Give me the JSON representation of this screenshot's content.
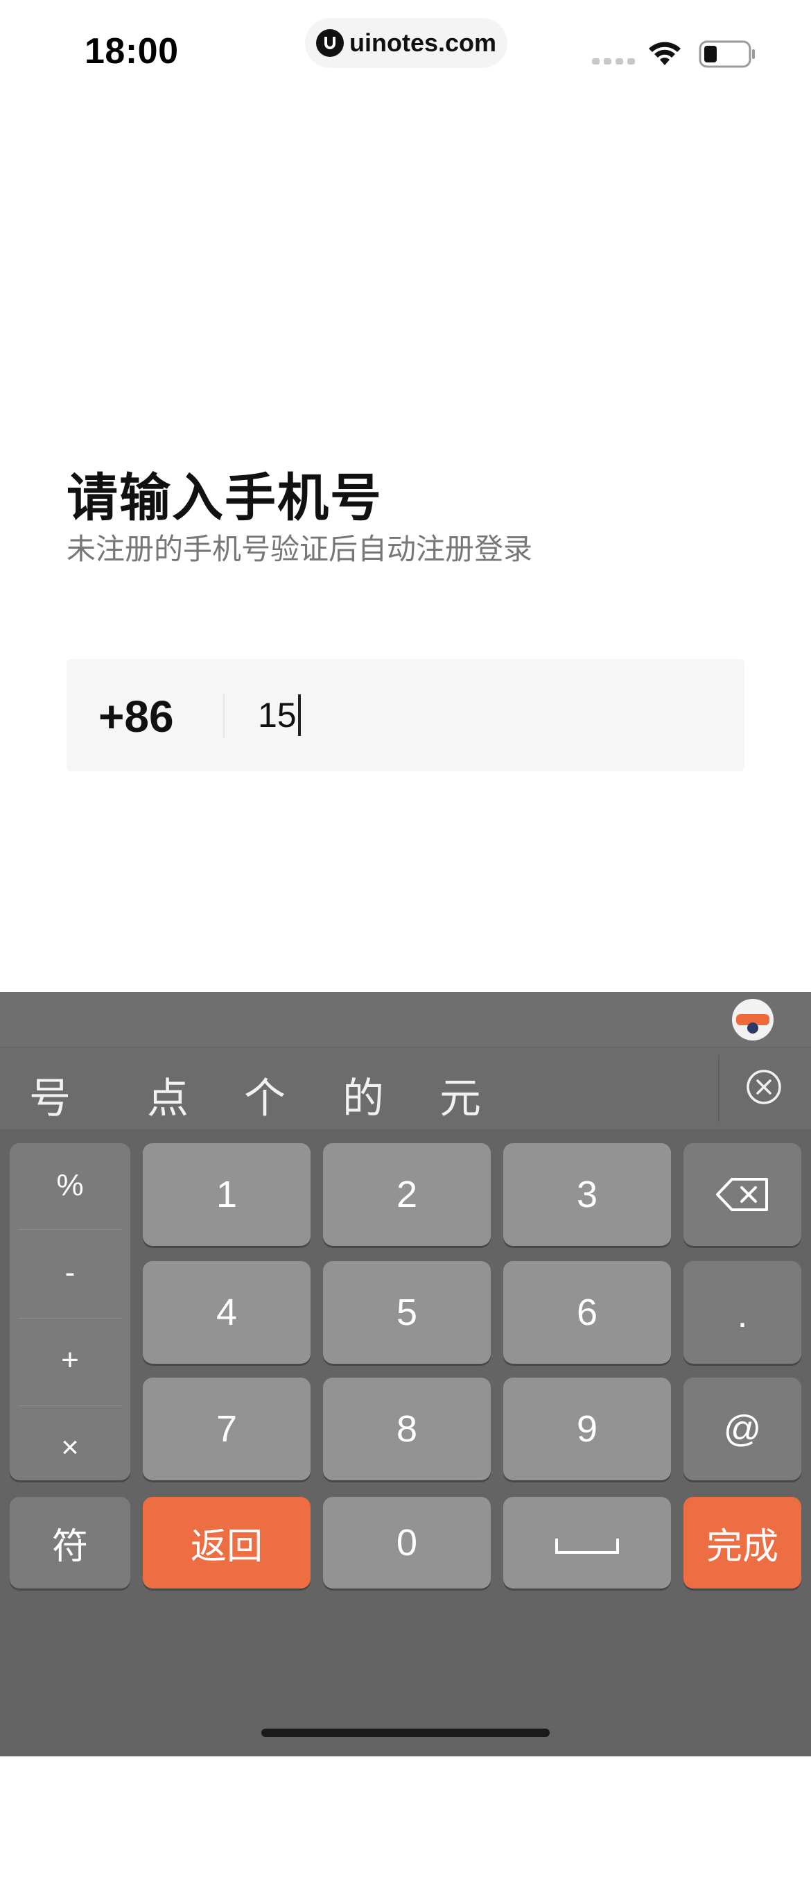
{
  "status_bar": {
    "time": "18:00",
    "watermark": "uinotes.com"
  },
  "login": {
    "title": "请输入手机号",
    "subtitle": "未注册的手机号验证后自动注册登录",
    "country_code": "+86",
    "phone_value": "15"
  },
  "keyboard": {
    "candidates": [
      "号",
      "点",
      "个",
      "的",
      "元"
    ],
    "symbols": [
      "%",
      "-",
      "+",
      "×"
    ],
    "digits": [
      "1",
      "2",
      "3",
      "4",
      "5",
      "6",
      "7",
      "8",
      "9",
      "0"
    ],
    "dot_label": ".",
    "at_label": "@",
    "symbols_key": "符",
    "back_key": "返回",
    "done_key": "完成"
  },
  "colors": {
    "accent": "#ee6e44",
    "keyboard_bg": "#646464",
    "key_bg": "#939393"
  }
}
